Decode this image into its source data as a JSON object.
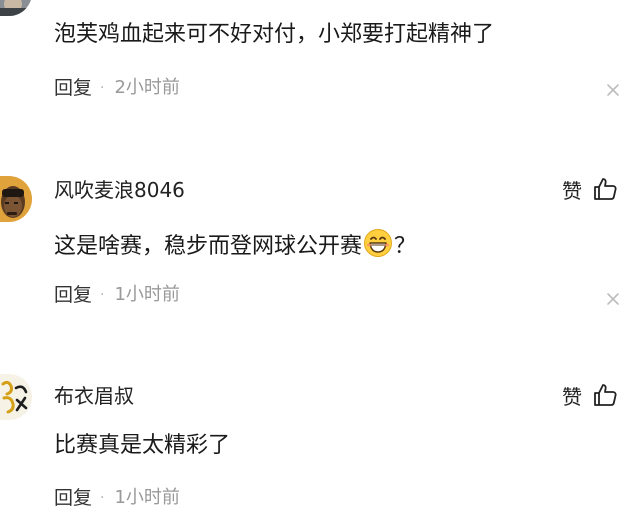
{
  "comments": [
    {
      "username": "",
      "text": "泡芙鸡血起来可不好对付，小郑要打起精神了",
      "reply_label": "回复",
      "separator": "·",
      "time": "2小时前",
      "like_label": ""
    },
    {
      "username": "风吹麦浪8046",
      "text_before": "这是啥赛，稳步而登网球公开赛",
      "text_after": "？",
      "reply_label": "回复",
      "separator": "·",
      "time": "1小时前",
      "like_label": "赞"
    },
    {
      "username": "布衣眉叔",
      "text": "比赛真是太精彩了",
      "reply_label": "回复",
      "separator": "·",
      "time": "1小时前",
      "like_label": "赞"
    }
  ],
  "icons": {
    "like": "thumbs-up-icon",
    "close": "close-icon",
    "emoji": "grinning-face-emoji"
  }
}
